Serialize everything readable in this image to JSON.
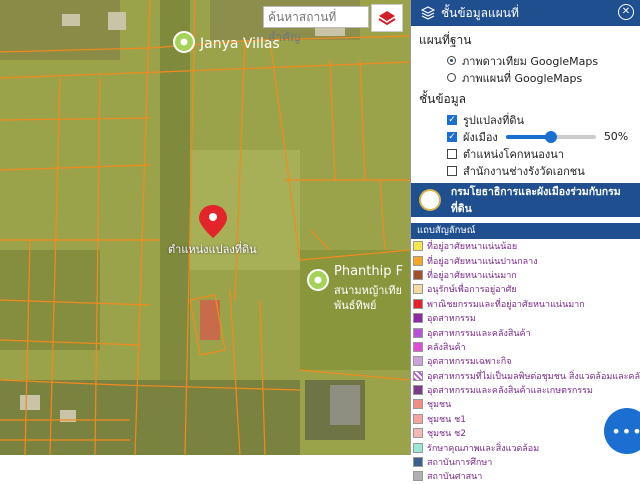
{
  "map": {
    "labels": {
      "place1": "Janya Villas",
      "place2": "Phanthip F",
      "place2_sub1": "สนามหญ้าเทีย",
      "place2_sub2": "พันธ์ทิพย์",
      "pin_label": "ตำแหน่งแปลงที่ดิน"
    }
  },
  "search": {
    "placeholder": "ค้นหาสถานที่สำคัญ"
  },
  "panel": {
    "title": "ชั้นข้อมูลแผนที่",
    "basemap_heading": "แผนที่ฐาน",
    "basemaps": [
      {
        "label": "ภาพดาวเทียม GoogleMaps",
        "selected": true
      },
      {
        "label": "ภาพแผนที่ GoogleMaps",
        "selected": false
      }
    ],
    "layers_heading": "ชั้นข้อมูล",
    "layers": [
      {
        "label": "รูปแปลงที่ดิน",
        "checked": true
      },
      {
        "label": "ผังเมือง",
        "checked": true
      },
      {
        "label": "ตำแหน่งโคกหนองนา",
        "checked": false
      },
      {
        "label": "สำนักงานช่างรังวัดเอกชน",
        "checked": false
      }
    ],
    "opacity": {
      "value": 0.5,
      "text": "50%"
    },
    "banner": "กรมโยธาธิการและผังเมืองร่วมกับกรมที่ดิน",
    "legend_title": "แถบสัญลักษณ์",
    "legend": [
      {
        "label": "ที่อยู่อาศัยหนาแน่นน้อย",
        "color": "#f7e64a"
      },
      {
        "label": "ที่อยู่อาศัยหนาแน่นปานกลาง",
        "color": "#f5a623"
      },
      {
        "label": "ที่อยู่อาศัยหนาแน่นมาก",
        "color": "#a0522d"
      },
      {
        "label": "อนุรักษ์เพื่อการอยู่อาศัย",
        "color": "#f4d9a0"
      },
      {
        "label": "พาณิชยกรรมและที่อยู่อาศัยหนาแน่นมาก",
        "color": "#e3242b"
      },
      {
        "label": "อุตสาหกรรม",
        "color": "#8e2ba3"
      },
      {
        "label": "อุตสาหกรรมและคลังสินค้า",
        "color": "#b552d9"
      },
      {
        "label": "คลังสินค้า",
        "color": "#e04fd3"
      },
      {
        "label": "อุตสาหกรรมเฉพาะกิจ",
        "color": "#c9a3d9"
      },
      {
        "label": "อุตสาหกรรมที่ไม่เป็นมลพิษต่อชุมชน สิ่งแวดล้อมและคลังสินค้า",
        "color": "#ffffff"
      },
      {
        "label": "อุตสาหกรรมและคลังสินค้าและเกษตรกรรม",
        "color": "#7d3b8a"
      },
      {
        "label": "ชุมชน",
        "color": "#f28b82"
      },
      {
        "label": "ชุมชน ช1",
        "color": "#f5a5a0"
      },
      {
        "label": "ชุมชน ช2",
        "color": "#f7b8b4"
      },
      {
        "label": "รักษาคุณภาพและสิ่งแวดล้อม",
        "color": "#9be7d6"
      },
      {
        "label": "สถาบันการศึกษา",
        "color": "#3d5f8f"
      },
      {
        "label": "สถาบันศาสนา",
        "color": "#b0b0b0"
      }
    ]
  },
  "fab": {
    "label": "•••"
  }
}
